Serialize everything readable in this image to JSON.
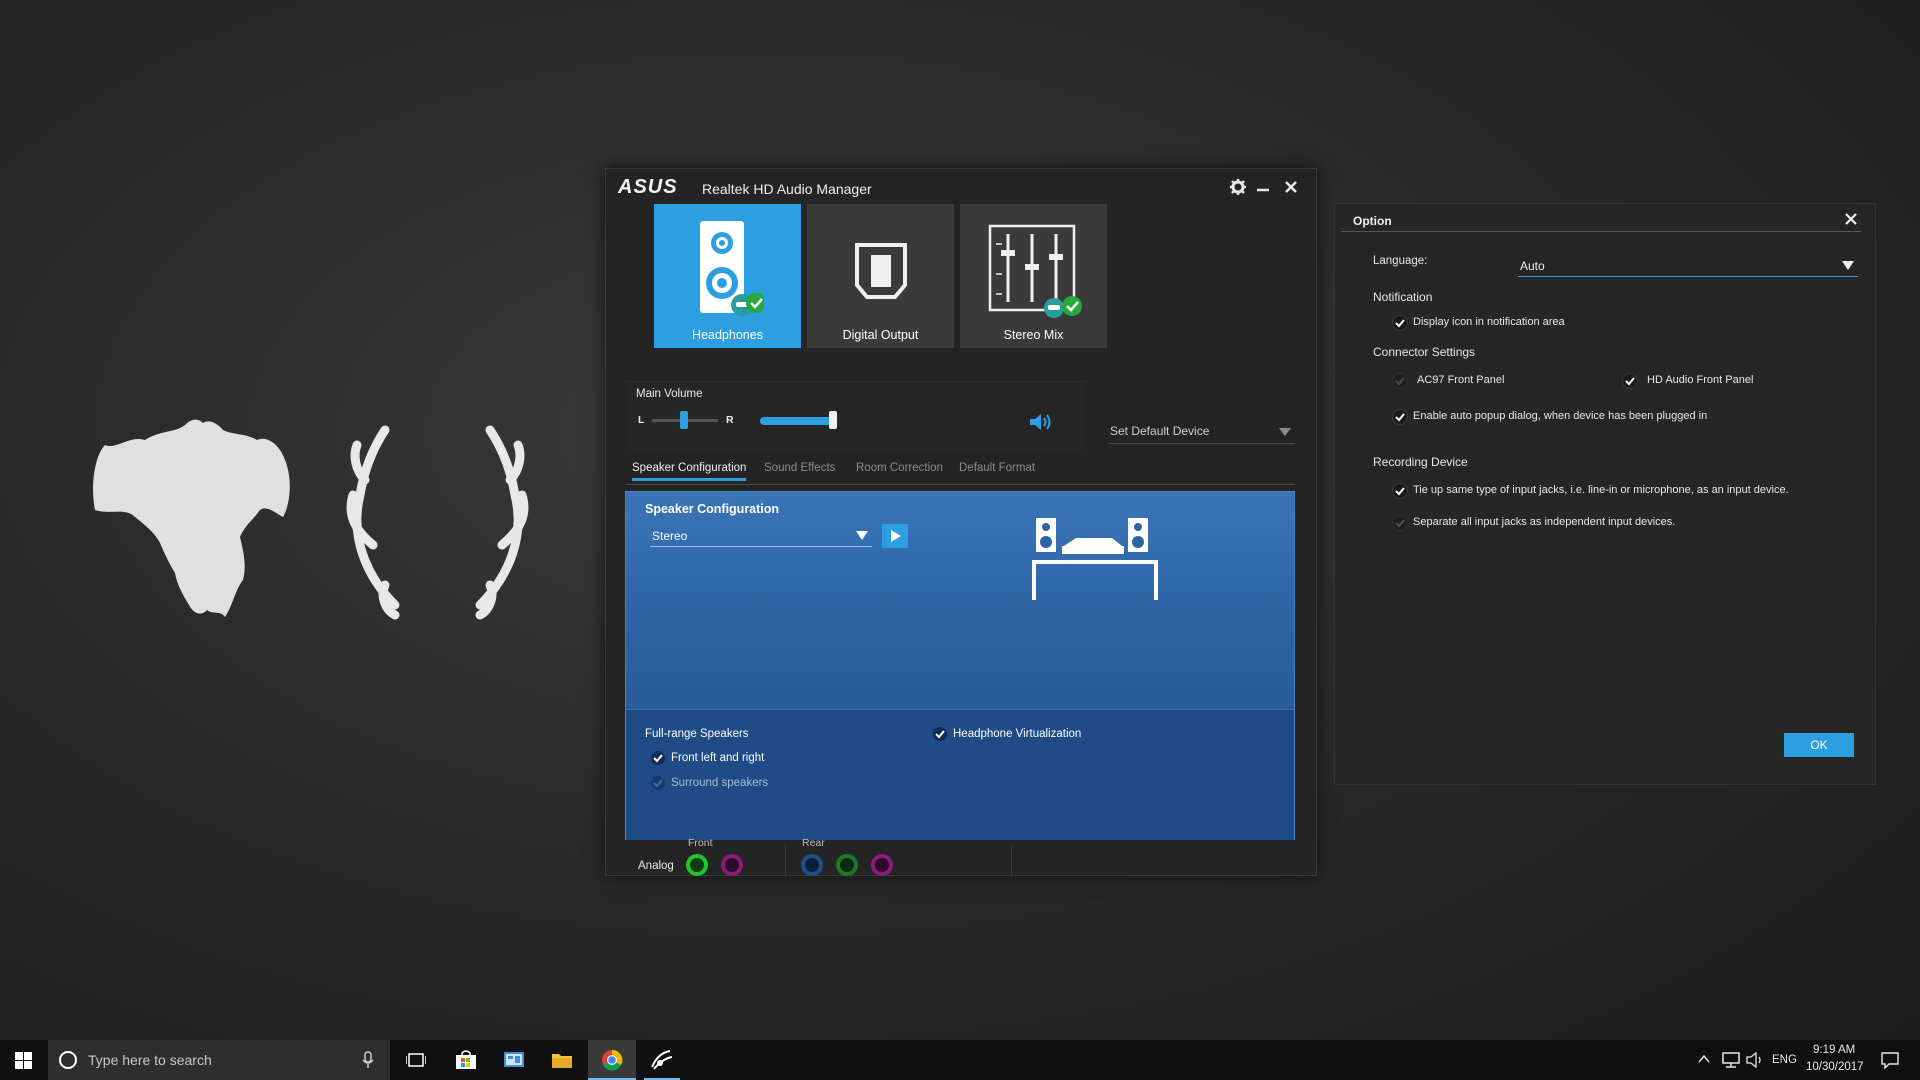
{
  "window": {
    "brand": "ASUS",
    "title": "Realtek HD Audio Manager"
  },
  "devices": [
    {
      "label": "Headphones",
      "active": true,
      "icon": "speaker-icon"
    },
    {
      "label": "Digital Output",
      "active": false,
      "icon": "digital-output-icon"
    },
    {
      "label": "Stereo Mix",
      "active": false,
      "icon": "mixer-icon"
    }
  ],
  "volume": {
    "title": "Main Volume",
    "left_label": "L",
    "right_label": "R",
    "balance": 0.5,
    "level": 1.0
  },
  "set_default": {
    "label": "Set Default Device"
  },
  "tabs": [
    "Speaker Configuration",
    "Sound Effects",
    "Room Correction",
    "Default Format"
  ],
  "speaker_config": {
    "title": "Speaker Configuration",
    "selected": "Stereo",
    "full_range_title": "Full-range Speakers",
    "front_lr": "Front left and right",
    "front_lr_checked": true,
    "surround": "Surround speakers",
    "surround_checked": false,
    "headphone_virtualization": "Headphone Virtualization",
    "headphone_virtualization_checked": true
  },
  "jacks": {
    "analog_label": "Analog",
    "front_label": "Front",
    "rear_label": "Rear",
    "colors": {
      "green": "#1fc62b",
      "pink": "#a0168c",
      "blue": "#1e4f8e",
      "dark_green": "#1a7a2a",
      "dark_pink": "#8e1a7c"
    }
  },
  "option": {
    "title": "Option",
    "language_label": "Language:",
    "language_value": "Auto",
    "notification_label": "Notification",
    "display_icon": "Display icon in notification area",
    "connector_label": "Connector Settings",
    "ac97": "AC97 Front Panel",
    "hd_audio": "HD Audio Front Panel",
    "auto_popup": "Enable auto popup dialog, when device has been plugged in",
    "recording_label": "Recording Device",
    "tie_up": "Tie up same type of input jacks, i.e. line-in or microphone, as an input device.",
    "separate": "Separate all input jacks as independent input devices.",
    "ok": "OK"
  },
  "taskbar": {
    "search_placeholder": "Type here to search",
    "time": "9:19 AM",
    "date": "10/30/2017",
    "lang": "ENG"
  },
  "colors": {
    "accent": "#2d9fe0",
    "panel_blue": "#2e64a6"
  }
}
